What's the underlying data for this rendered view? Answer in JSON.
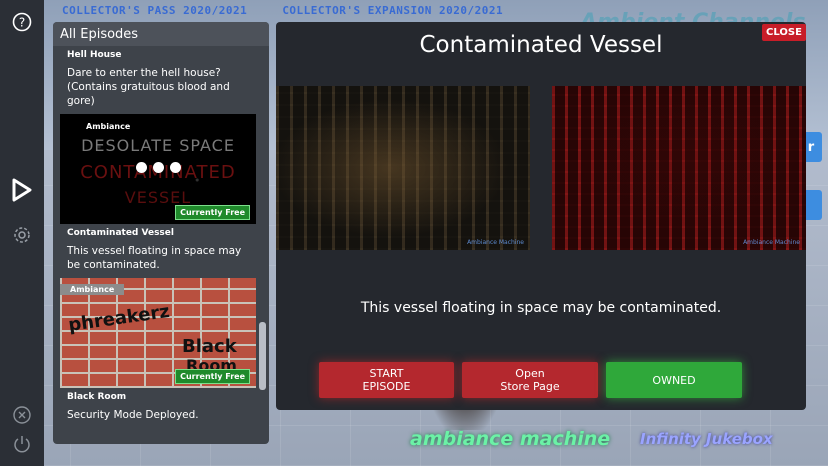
{
  "background": {
    "banner": [
      "COLLECTOR'S PASS 2020/2021",
      "COLLECTOR'S EXPANSION 2020/2021"
    ],
    "logo_text": "Ambient Channels",
    "side_button_labels": [
      "r",
      ""
    ]
  },
  "rail": {
    "help_icon": "help-icon",
    "play_icon": "play-icon",
    "settings_icon": "gear-icon",
    "close_icon": "close-icon",
    "power_icon": "power-icon"
  },
  "episodes": {
    "header": "All Episodes",
    "items": [
      {
        "title": "Hell House",
        "description": "Dare to enter the hell house? (Contains gratuitous blood and gore)",
        "tag": "",
        "badge": ""
      },
      {
        "title": "Contaminated Vessel",
        "description": "This vessel floating in space may be contaminated.",
        "tag": "Ambiance",
        "badge": "Currently Free",
        "thumb_line1": "DESOLATE SPACE",
        "thumb_line2": "CONTAMINATED",
        "thumb_line3": "VESSEL"
      },
      {
        "title": "Black Room",
        "description": "Security Mode Deployed.",
        "tag": "Ambiance",
        "badge": "Currently Free",
        "thumb_line1": "phreakerz",
        "thumb_line2": "Black",
        "thumb_line3": "Room"
      }
    ]
  },
  "dialog": {
    "title": "Contaminated Vessel",
    "close_label": "CLOSE",
    "screenshot_mark": "Ambiance Machine",
    "description": "This vessel floating in space may be contaminated.",
    "start_label": "START\nEPISODE",
    "store_label": "Open\nStore Page",
    "owned_label": "OWNED"
  },
  "footer": {
    "logo_left": "ambiance machine",
    "logo_right": "Infinity Jukebox"
  },
  "colors": {
    "rail": "#2b2f36",
    "panel": "#3e434a",
    "dialog": "#25282e",
    "red_button": "#b4282e",
    "green_button": "#2fa83a",
    "close_button": "#c81d28"
  }
}
